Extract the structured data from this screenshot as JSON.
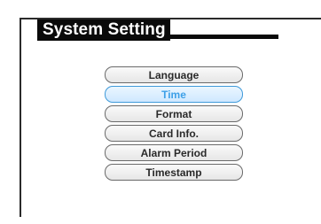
{
  "header": {
    "title": "System Setting"
  },
  "menu": {
    "items": [
      {
        "label": "Language",
        "selected": false
      },
      {
        "label": "Time",
        "selected": true
      },
      {
        "label": "Format",
        "selected": false
      },
      {
        "label": "Card Info.",
        "selected": false
      },
      {
        "label": "Alarm Period",
        "selected": false
      },
      {
        "label": "Timestamp",
        "selected": false
      }
    ]
  },
  "colors": {
    "frame": "#2a2a2a",
    "title_background": "#0a0a0a",
    "title_text": "#ffffff",
    "button_border": "#6a6a6a",
    "button_text": "#2a2a2a",
    "selected_border": "#3f9ad9",
    "selected_text": "#3da0e8",
    "selected_fill": "#cfe8ff"
  }
}
